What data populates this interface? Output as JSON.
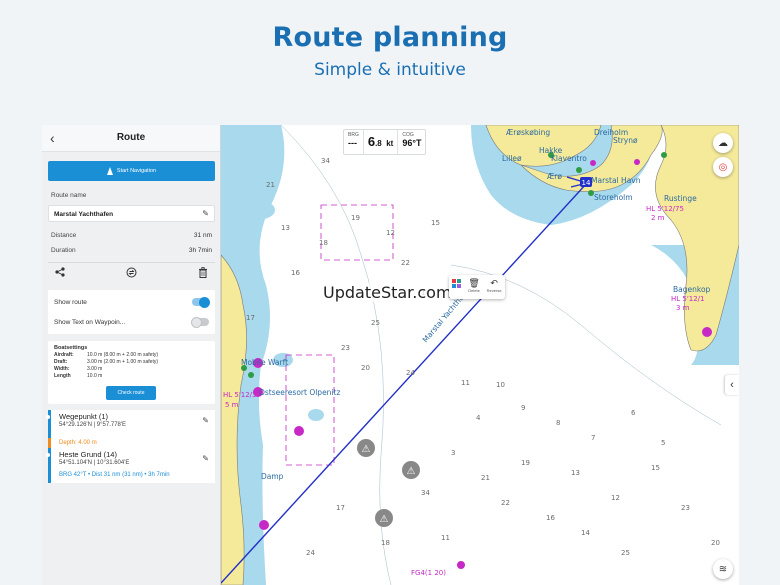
{
  "promo": {
    "title": "Route planning",
    "subtitle": "Simple & intuitive"
  },
  "panel": {
    "back_icon": "chevron-left-icon",
    "title": "Route",
    "start_navigation": "Start Navigation",
    "route_name_label": "Route name",
    "route_name_value": "Marstal Yachthafen",
    "distance_label": "Distance",
    "distance_value": "31 nm",
    "duration_label": "Duration",
    "duration_value": "3h 7min",
    "actions": [
      "share-icon",
      "reverse-route-icon",
      "trash-icon"
    ],
    "toggles": [
      {
        "label": "Show route",
        "on": true
      },
      {
        "label": "Show Text on Waypoin...",
        "on": false
      }
    ],
    "boatsettings": {
      "title": "Boatsettings",
      "rows": [
        {
          "key": "Airdraft:",
          "value": "10.0 m (8.00 m + 2.00 m safety)"
        },
        {
          "key": "Draft:",
          "value": "3.00 m (2.00 m + 1.00 m safety)"
        },
        {
          "key": "Width:",
          "value": "3.00 m"
        },
        {
          "key": "Length",
          "value": "10.0 m"
        }
      ],
      "check_route": "Check route"
    },
    "waypoints": [
      {
        "name": "Wegepunkt (1)",
        "coords": "54°29.126'N | 9°57.778'E"
      },
      {
        "name": "Heste Grund (14)",
        "coords": "54°51.104'N | 10°31.604'E"
      }
    ],
    "depth_warning": "Depth: 4.00 m",
    "bearing_info": "BRG 42°T • Dist 31 nm (31 nm) • 3h 7min"
  },
  "map": {
    "instruments": {
      "brg_label": "BRG",
      "brg_value": "---",
      "sog_big": "6",
      "sog_decimal": ".8",
      "sog_unit": "kt",
      "cog_label": "COG",
      "cog_value": "96°T"
    },
    "watermark": "UpdateStar.com",
    "context_menu": {
      "delete": "Delete",
      "reverse": "Reverse"
    },
    "context_colors": [
      "#e63946",
      "#2a9d8f",
      "#1b8fd6",
      "#9b5de5"
    ],
    "route_label": "Marstal Yachthafen",
    "waypoint_badge": "14",
    "places": {
      "aeroskobing": "Ærøskøbing",
      "dreiholm": "Dreiholm",
      "strynø": "Strynø",
      "hakke": "Hakke",
      "klaventro": "Klaventro",
      "lilleo": "Lilleø",
      "ero": "Ærø",
      "marstal_havn": "Marstal Havn",
      "storeholm": "Storeholm",
      "rustinge": "Rustinge",
      "bagenkop": "Bagenkop",
      "hl_bagenkop": "HL 5'12/1",
      "hl_rustinge": "HL 5'12/75",
      "m3": "3 m",
      "m2": "2 m",
      "mobile_warft": "Mobile Warft",
      "ostseeresort": "Ostseeresort Olpenitz",
      "damp": "Damp",
      "hl_wp": "HL 5'12/3",
      "m5": "5 m",
      "fog": "FG4(1 20)"
    },
    "depths": [
      "34",
      "21",
      "19",
      "13",
      "12",
      "15",
      "17",
      "18",
      "22",
      "16",
      "14",
      "25",
      "23",
      "20",
      "24",
      "11",
      "10",
      "9",
      "8",
      "7",
      "6",
      "5",
      "4",
      "3"
    ],
    "fab_icons": [
      "weather-icon",
      "lifebuoy-icon",
      "layers-icon"
    ],
    "side_arrow": "chevron-left-icon"
  },
  "colors": {
    "accent": "#1b8fd6",
    "title": "#1a6fb3",
    "land": "#f5ea9a",
    "shallow": "#a8d9ec",
    "route": "#2230c9",
    "magenta": "#c629c6",
    "warning": "#f28b1f"
  }
}
